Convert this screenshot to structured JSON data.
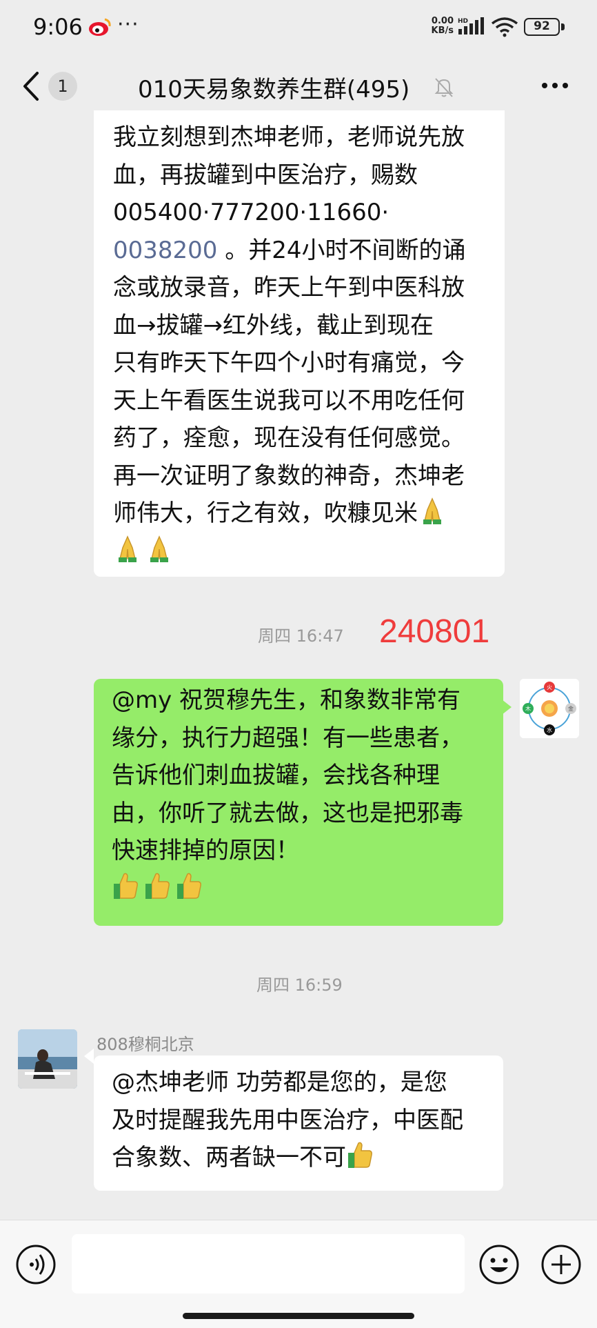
{
  "status_bar": {
    "time": "9:06",
    "dots": "···",
    "speed_top": "0.00",
    "speed_bottom": "KB/s",
    "hd": "HD",
    "battery": "92"
  },
  "nav": {
    "unread_count": "1",
    "title": "010天易象数养生群(495)"
  },
  "messages": {
    "msg1": {
      "lines": [
        "我立刻想到杰坤老师，老师说先放",
        "血，再拔罐到中医治疗，赐数",
        "005400·777200·11660·"
      ],
      "link_number": "0038200",
      "line4_rest": " 。并24小时不间断的诵",
      "lines_after": [
        "念或放录音，昨天上午到中医科放",
        "血→拔罐→红外线，截止到现在",
        "只有昨天下午四个小时有痛觉，今",
        "天上午看医生说我可以不用吃任何",
        "药了，痊愈，现在没有任何感觉。",
        "再一次证明了象数的神奇，杰坤老",
        "师伟大，行之有效，吹糠见米"
      ]
    },
    "time1": "周四 16:47",
    "red_number": "240801",
    "msg2": {
      "lines": [
        "@my  祝贺穆先生，和象数非常有",
        "缘分，执行力超强！有一些患者，",
        "告诉他们刺血拔罐，会找各种理",
        "由，你听了就去做，这也是把邪毒",
        "快速排掉的原因！"
      ]
    },
    "time2": "周四 16:59",
    "msg3": {
      "sender": "808穆桐北京",
      "lines": [
        "@杰坤老师  功劳都是您的，是您",
        "及时提醒我先用中医治疗，中医配",
        "合象数、两者缺一不可"
      ]
    }
  },
  "avatar_me_labels": {
    "top": "火",
    "left": "木",
    "right": "金",
    "bottom": "水"
  },
  "colors": {
    "background": "#ededed",
    "bubble_green": "#95ec69",
    "bubble_white": "#ffffff",
    "red_number": "#ef3c3c",
    "link_number": "#5a6b94"
  },
  "icons": {
    "back": "chevron-left-icon",
    "mute": "bell-off-icon",
    "more": "more-dots-icon",
    "voice": "voice-icon",
    "emoji": "emoji-icon",
    "plus": "plus-icon",
    "pray": "folded-hands-emoji",
    "thumbs": "thumbs-up-emoji"
  }
}
